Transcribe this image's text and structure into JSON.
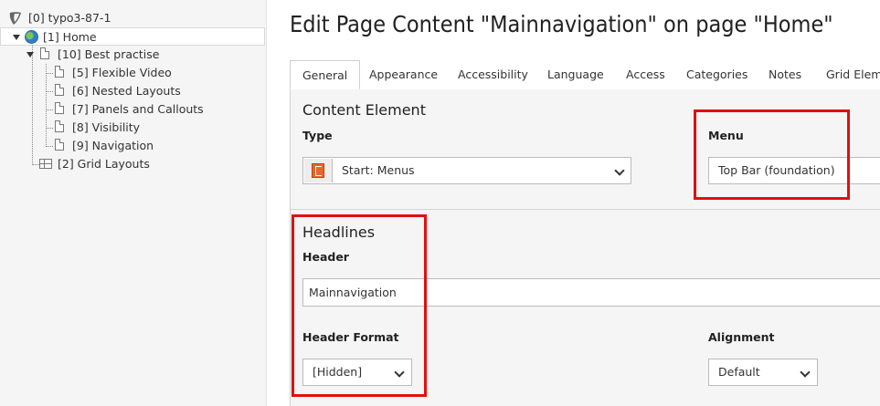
{
  "tree": {
    "root": "[0] typo3-87-1",
    "home": "[1] Home",
    "best_practise": "[10] Best practise",
    "children": [
      "[5] Flexible Video",
      "[6] Nested Layouts",
      "[7] Panels and Callouts",
      "[8] Visibility",
      "[9] Navigation"
    ],
    "grid_layouts": "[2] Grid Layouts"
  },
  "page_title": "Edit Page Content \"Mainnavigation\" on page \"Home\"",
  "tabs": [
    "General",
    "Appearance",
    "Accessibility",
    "Language",
    "Access",
    "Categories",
    "Notes",
    "Grid Eleme"
  ],
  "active_tab": "General",
  "content_element": {
    "section_title": "Content Element",
    "type_label": "Type",
    "type_value": "Start: Menus",
    "menu_label": "Menu",
    "menu_value": "Top Bar (foundation)"
  },
  "headlines": {
    "section_title": "Headlines",
    "header_label": "Header",
    "header_value": "Mainnavigation",
    "header_format_label": "Header Format",
    "header_format_value": "[Hidden]",
    "alignment_label": "Alignment",
    "alignment_value": "Default"
  },
  "colors": {
    "highlight": "#e10f0f",
    "ctype_icon": "#e8662b"
  }
}
